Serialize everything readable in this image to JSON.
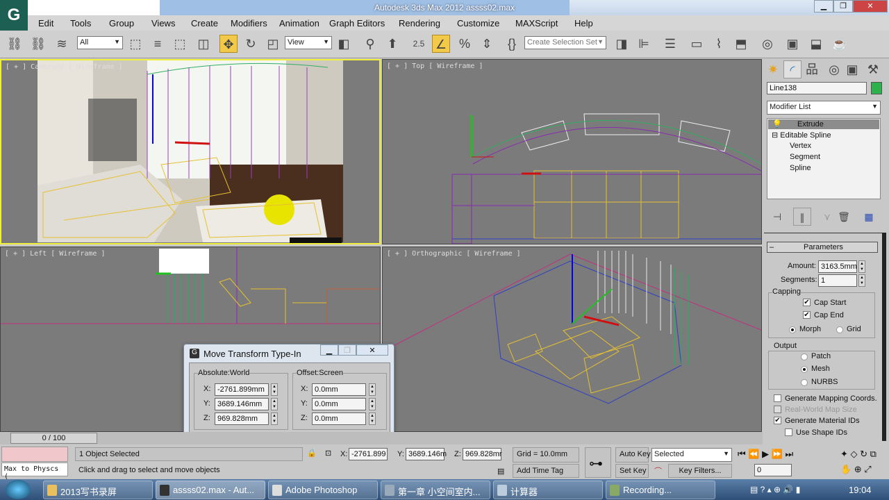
{
  "window": {
    "title": "Autodesk 3ds Max  2012      assss02.max",
    "logo": "G"
  },
  "menu": [
    "Edit",
    "Tools",
    "Group",
    "Views",
    "Create",
    "Modifiers",
    "Animation",
    "Graph Editors",
    "Rendering",
    "Customize",
    "MAXScript",
    "Help"
  ],
  "toolbar": {
    "filter": "All",
    "ref_coord": "View",
    "snap_value": "2.5",
    "selection_set_placeholder": "Create Selection Set"
  },
  "viewports": {
    "camera": "[ + ] Camera02 [ Wireframe ]",
    "top": "[ + ] Top [ Wireframe ]",
    "left": "[ + ] Left [ Wireframe ]",
    "ortho": "[ + ] Orthographic [ Wireframe ]"
  },
  "command_panel": {
    "object_name": "Line138",
    "object_color": "#2bb24c",
    "modifier_list": "Modifier List",
    "stack": [
      "Extrude",
      "Editable Spline",
      "Vertex",
      "Segment",
      "Spline"
    ],
    "rollout": "Parameters",
    "amount_label": "Amount:",
    "amount": "3163.5mm",
    "segments_label": "Segments:",
    "segments": "1",
    "capping": "Capping",
    "cap_start": "Cap Start",
    "cap_end": "Cap End",
    "morph": "Morph",
    "grid": "Grid",
    "output": "Output",
    "patch": "Patch",
    "mesh": "Mesh",
    "nurbs": "NURBS",
    "gen_mapping": "Generate Mapping Coords.",
    "real_world": "Real-World Map Size",
    "gen_mat_ids": "Generate Material IDs",
    "use_shape_ids": "Use Shape IDs"
  },
  "dialog": {
    "title": "Move Transform Type-In",
    "absolute": "Absolute:World",
    "offset": "Offset:Screen",
    "abs_x": "-2761.899mm",
    "abs_y": "3689.146mm",
    "abs_z": "969.828mm",
    "off_x": "0.0mm",
    "off_y": "0.0mm",
    "off_z": "0.0mm",
    "x": "X:",
    "y": "Y:",
    "z": "Z:"
  },
  "timeline": {
    "frame": "0 / 100"
  },
  "status": {
    "listener": "Max to Physcs (",
    "selected": "1 Object Selected",
    "prompt": "Click and drag to select and move objects",
    "x": "-2761.899",
    "y": "3689.146m",
    "z": "969.828mr",
    "grid": "Grid = 10.0mm",
    "add_time_tag": "Add Time Tag",
    "auto_key": "Auto Key",
    "set_key": "Set Key",
    "key_mode": "Selected",
    "key_filters": "Key Filters...",
    "frame": "0"
  },
  "taskbar": {
    "items": [
      "2013写书录屏",
      "assss02.max - Aut...",
      "Adobe Photoshop",
      "第一章 小空间室内...",
      "计算器",
      "Recording..."
    ],
    "clock": "19:04"
  }
}
